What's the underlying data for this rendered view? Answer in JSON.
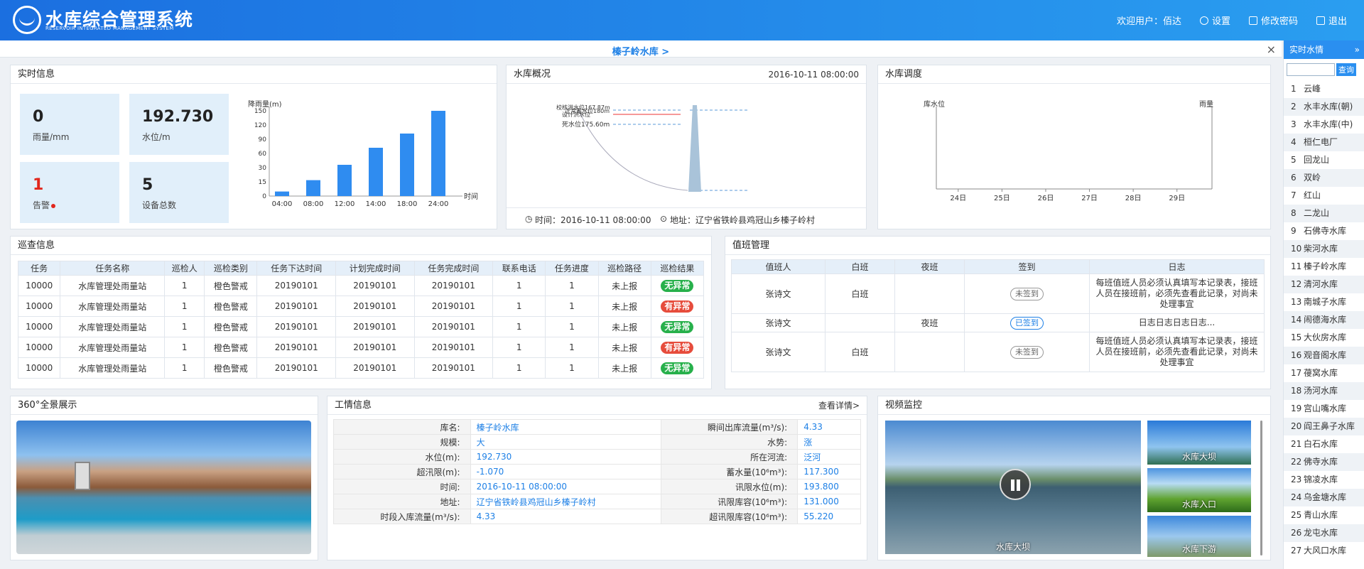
{
  "header": {
    "title": "水库综合管理系统",
    "subtitle": "RESERVOIR INTEGRATED MANAGEMENT SYSTEM",
    "welcome": "欢迎用户：佰达",
    "settings": "设置",
    "change_password": "修改密码",
    "logout": "退出"
  },
  "breadcrumb": {
    "text": "榛子岭水库 >",
    "close": "×"
  },
  "realtime": {
    "title": "实时信息",
    "kpis": [
      {
        "value": "0",
        "label": "雨量/mm"
      },
      {
        "value": "192.730",
        "label": "水位/m"
      },
      {
        "value": "1",
        "label": "告警"
      },
      {
        "value": "5",
        "label": "设备总数"
      }
    ]
  },
  "rain_chart": {
    "chart_data": {
      "type": "bar",
      "ylabel": "降雨量(m)",
      "xlabel": "时间",
      "categories": [
        "04:00",
        "08:00",
        "12:00",
        "14:00",
        "18:00",
        "24:00"
      ],
      "values": [
        8,
        28,
        55,
        85,
        110,
        150
      ],
      "yticks": [
        0,
        15,
        30,
        60,
        90,
        120,
        150
      ]
    }
  },
  "overview": {
    "title": "水库概况",
    "time": "2016-10-11 08:00:00",
    "labels": {
      "check_flood": "校核洪水位167.87m",
      "normal": "正常蓄水位180m",
      "design": "设计洪水位",
      "dead": "死水位175.60m"
    },
    "footer_time": "时间：2016-10-11 08:00:00",
    "footer_address": "地址：辽宁省铁岭县鸡冠山乡榛子岭村"
  },
  "dispatch": {
    "title": "水库调度",
    "chart_data": {
      "type": "line",
      "ylabel_left": "库水位",
      "ylabel_right": "雨量",
      "categories": [
        "24日",
        "25日",
        "26日",
        "27日",
        "28日",
        "29日"
      ],
      "series": []
    }
  },
  "inspection": {
    "title": "巡查信息",
    "columns": [
      "任务",
      "任务名称",
      "巡检人",
      "巡检类别",
      "任务下达时间",
      "计划完成时间",
      "任务完成时间",
      "联系电话",
      "任务进度",
      "巡检路径",
      "巡检结果"
    ],
    "rows": [
      [
        "10000",
        "水库管理处雨量站",
        "1",
        "橙色警戒",
        "20190101",
        "20190101",
        "20190101",
        "1",
        "1",
        "未上报",
        "无异常"
      ],
      [
        "10000",
        "水库管理处雨量站",
        "1",
        "橙色警戒",
        "20190101",
        "20190101",
        "20190101",
        "1",
        "1",
        "未上报",
        "有异常"
      ],
      [
        "10000",
        "水库管理处雨量站",
        "1",
        "橙色警戒",
        "20190101",
        "20190101",
        "20190101",
        "1",
        "1",
        "未上报",
        "无异常"
      ],
      [
        "10000",
        "水库管理处雨量站",
        "1",
        "橙色警戒",
        "20190101",
        "20190101",
        "20190101",
        "1",
        "1",
        "未上报",
        "有异常"
      ],
      [
        "10000",
        "水库管理处雨量站",
        "1",
        "橙色警戒",
        "20190101",
        "20190101",
        "20190101",
        "1",
        "1",
        "未上报",
        "无异常"
      ]
    ]
  },
  "duty": {
    "title": "值班管理",
    "columns": [
      "值班人",
      "白班",
      "夜班",
      "签到",
      "日志"
    ],
    "rows": [
      {
        "person": "张诗文",
        "day": "白班",
        "night": "",
        "sign": "未签到",
        "log": "每班值班人员必须认真填写本记录表，接班人员在接班前，必须先查看此记录，对尚未处理事宜"
      },
      {
        "person": "张诗文",
        "day": "",
        "night": "夜班",
        "sign": "已签到",
        "log": "日志日志日志日志..."
      },
      {
        "person": "张诗文",
        "day": "白班",
        "night": "",
        "sign": "未签到",
        "log": "每班值班人员必须认真填写本记录表，接班人员在接班前，必须先查看此记录，对尚未处理事宜"
      }
    ]
  },
  "panorama": {
    "title": "360°全景展示"
  },
  "work": {
    "title": "工情信息",
    "more": "查看详情>",
    "rows": [
      [
        "库名:",
        "榛子岭水库",
        "瞬间出库流量(m³/s):",
        "4.33"
      ],
      [
        "规模:",
        "大",
        "水势:",
        "涨"
      ],
      [
        "水位(m):",
        "192.730",
        "所在河流:",
        "泛河"
      ],
      [
        "超汛限(m):",
        "-1.070",
        "蓄水量(10⁶m³):",
        "117.300"
      ],
      [
        "时间:",
        "2016-10-11 08:00:00",
        "讯限水位(m):",
        "193.800"
      ],
      [
        "地址:",
        "辽宁省铁岭县鸡冠山乡榛子岭村",
        "讯限库容(10⁶m³):",
        "131.000"
      ],
      [
        "时段入库流量(m³/s):",
        "4.33",
        "超讯限库容(10⁶m³):",
        "55.220"
      ]
    ]
  },
  "video": {
    "title": "视频监控",
    "main_caption": "水库大坝",
    "thumbs": [
      "水库大坝",
      "水库入口",
      "水库下游"
    ]
  },
  "side": {
    "title": "实时水情",
    "arrow": "»",
    "search_button": "查询",
    "items": [
      "云峰",
      "水丰水库(朝)",
      "水丰水库(中)",
      "桓仁电厂",
      "回龙山",
      "双岭",
      "红山",
      "二龙山",
      "石佛寺水库",
      "柴河水库",
      "榛子岭水库",
      "清河水库",
      "南城子水库",
      "闹德海水库",
      "大伙房水库",
      "观音阁水库",
      "葠窝水库",
      "汤河水库",
      "宫山嘴水库",
      "阎王鼻子水库",
      "白石水库",
      "佛寺水库",
      "锦凌水库",
      "乌金塘水库",
      "青山水库",
      "龙屯水库",
      "大风口水库"
    ]
  }
}
